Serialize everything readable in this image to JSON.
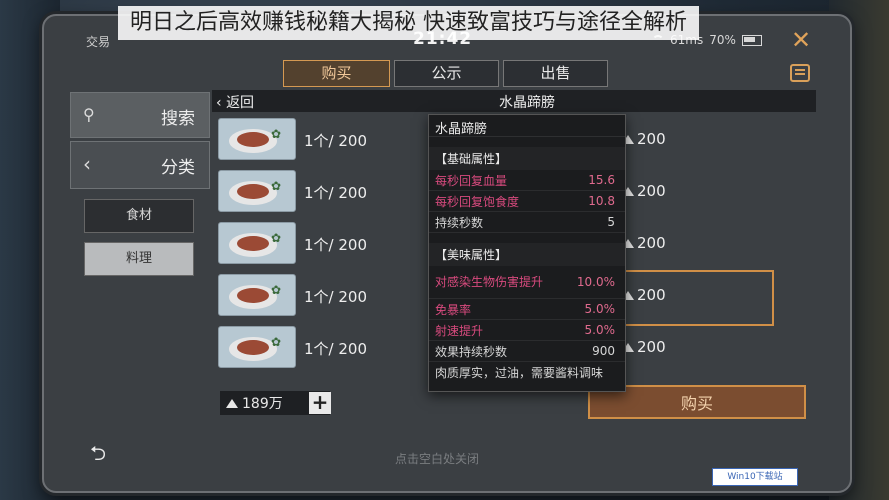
{
  "overlay_title": "明日之后高效赚钱秘籍大揭秘 快速致富技巧与途径全解析",
  "status": {
    "screen_name": "交易",
    "clock": "21:42",
    "network": "61ms",
    "battery": "70%"
  },
  "tabs": [
    {
      "label": "购买"
    },
    {
      "label": "公示"
    },
    {
      "label": "出售"
    }
  ],
  "sidebar": {
    "search_label": "搜索",
    "category_label": "分类",
    "sub_items": [
      {
        "label": "食材"
      },
      {
        "label": "料理"
      }
    ]
  },
  "list": {
    "back_label": "返回",
    "title": "水晶蹄膀",
    "rows": [
      {
        "price": "1个/ 200",
        "right_price": "200"
      },
      {
        "price": "1个/ 200",
        "right_price": "200"
      },
      {
        "price": "1个/ 200",
        "right_price": "200"
      },
      {
        "price": "1个/ 200",
        "right_price": "200"
      },
      {
        "price": "1个/ 200",
        "right_price": "200"
      }
    ]
  },
  "currency": {
    "amount": "189万"
  },
  "buy_button": "购买",
  "hint": "点击空白处关闭",
  "watermark": "Win10下载站",
  "tooltip": {
    "title": "水晶蹄膀",
    "section_basic": "【基础属性】",
    "basic": [
      {
        "label": "每秒回复血量",
        "value": "15.6",
        "highlight": true
      },
      {
        "label": "每秒回复饱食度",
        "value": "10.8",
        "highlight": true
      },
      {
        "label": "持续秒数",
        "value": "5",
        "highlight": false
      }
    ],
    "section_taste": "【美味属性】",
    "taste": [
      {
        "label": "对感染生物伤害提升",
        "value": "10.0%",
        "highlight": true
      },
      {
        "label": "免暴率",
        "value": "5.0%",
        "highlight": true
      },
      {
        "label": "射速提升",
        "value": "5.0%",
        "highlight": true
      },
      {
        "label": "效果持续秒数",
        "value": "900",
        "highlight": false
      }
    ],
    "description": "肉质厚实，过油，需要酱料调味"
  },
  "colors": {
    "accent": "#d08f47",
    "highlight_text": "#d84a7e",
    "panel": "#3b3f43"
  }
}
